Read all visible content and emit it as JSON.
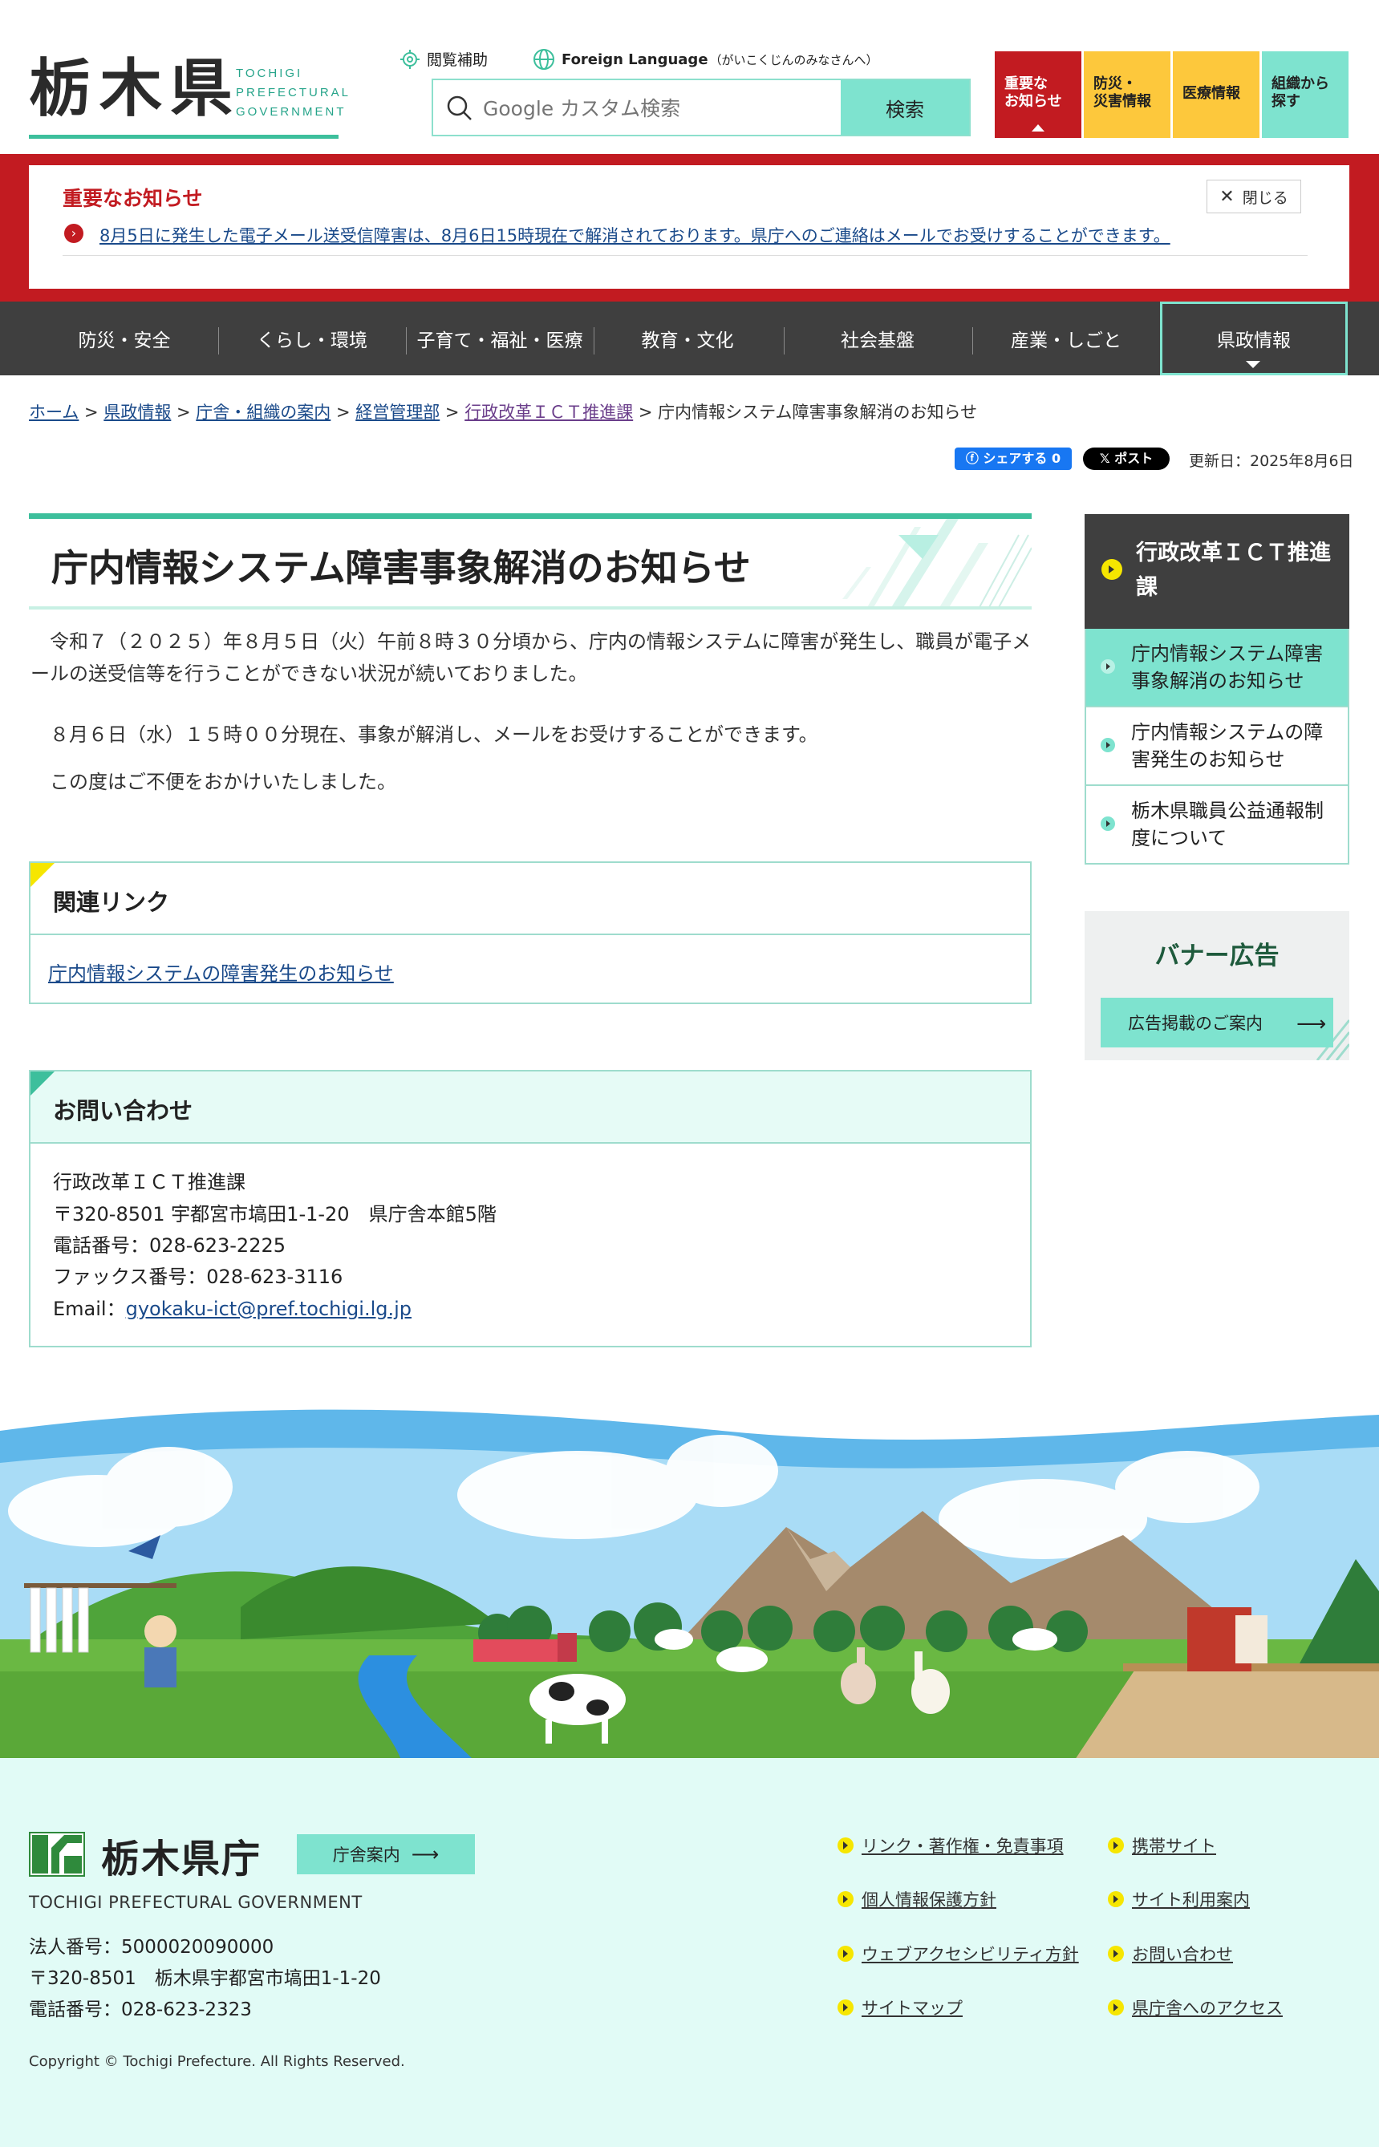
{
  "header": {
    "logo_kanji": "栃木県",
    "logo_en_lines": [
      "TOCHIGI",
      "PREFECTURAL",
      "GOVERNMENT"
    ],
    "accessibility_label": "閲覧補助",
    "foreign_language_label": "Foreign Language",
    "foreign_language_sub": "（がいこくじんのみなさんへ）",
    "search_placeholder": "Google カスタム検索",
    "search_button": "検索",
    "quick_links": [
      {
        "label_lines": [
          "重要な",
          "お知らせ"
        ],
        "color": "#c21b21"
      },
      {
        "label_lines": [
          "防災・",
          "災害情報"
        ],
        "color": "#fdc83c"
      },
      {
        "label_lines": [
          "医療情報"
        ],
        "color": "#fdc83c"
      },
      {
        "label_lines": [
          "組織から",
          "探す"
        ],
        "color": "#7ee3cf"
      }
    ]
  },
  "notice": {
    "title": "重要なお知らせ",
    "close_label": "閉じる",
    "link_text": "8月5日に発生した電子メール送受信障害は、8月6日15時現在で解消されております。県庁へのご連絡はメールでお受けすることができます。"
  },
  "nav": {
    "items": [
      "防災・安全",
      "くらし・環境",
      "子育て・福祉・医療",
      "教育・文化",
      "社会基盤",
      "産業・しごと",
      "県政情報"
    ],
    "current": "県政情報"
  },
  "breadcrumb": {
    "links": [
      "ホーム",
      "県政情報",
      "庁舎・組織の案内",
      "経営管理部",
      "行政改革ＩＣＴ推進課"
    ],
    "separator": " > ",
    "current": "庁内情報システム障害事象解消のお知らせ"
  },
  "share": {
    "facebook_label": "シェアする 0",
    "x_label": "ポスト",
    "updated": "更新日：2025年8月6日"
  },
  "article": {
    "title": "庁内情報システム障害事象解消のお知らせ",
    "paragraphs": [
      "　令和７（２０２５）年８月５日（火）午前８時３０分頃から、庁内の情報システムに障害が発生し、職員が電子メールの送受信等を行うことができない状況が続いておりました。",
      "　８月６日（水）１５時００分現在、事象が解消し、メールをお受けすることができます。",
      "　この度はご不便をおかけいたしました。"
    ]
  },
  "related": {
    "title": "関連リンク",
    "link": "庁内情報システムの障害発生のお知らせ"
  },
  "contact": {
    "title": "お問い合わせ",
    "department": "行政改革ＩＣＴ推進課",
    "address": "〒320-8501 宇都宮市塙田1-1-20　県庁舎本館5階",
    "phone": "電話番号：028-623-2225",
    "fax": "ファックス番号：028-623-3116",
    "email_label": "Email：",
    "email": "gyokaku-ict@pref.tochigi.lg.jp"
  },
  "sidebar": {
    "title": "行政改革ＩＣＴ推進課",
    "items": [
      {
        "label": "庁内情報システム障害事象解消のお知らせ"
      },
      {
        "label": "庁内情報システムの障害発生のお知らせ"
      },
      {
        "label": "栃木県職員公益通報制度について"
      }
    ],
    "banner_title": "バナー広告",
    "banner_button": "広告掲載のご案内"
  },
  "footer": {
    "name": "栃木県庁",
    "map_button": "庁舎案内",
    "en_name": "TOCHIGI PREFECTURAL GOVERNMENT",
    "corp_number": "法人番号：5000020090000",
    "address": "〒320-8501　栃木県宇都宮市塙田1-1-20",
    "phone": "電話番号：028-623-2323",
    "copyright": "Copyright © Tochigi Prefecture. All Rights Reserved.",
    "links": [
      "リンク・著作権・免責事項",
      "携帯サイト",
      "個人情報保護方針",
      "サイト利用案内",
      "ウェブアクセシビリティ方針",
      "お問い合わせ",
      "サイトマップ",
      "県庁舎へのアクセス"
    ]
  },
  "colors": {
    "accent": "#3dbf9c",
    "mint": "#7ee3cf",
    "alert_red": "#c21b21",
    "nav_dark": "#3f3f3f",
    "yellow": "#fdc83c"
  }
}
